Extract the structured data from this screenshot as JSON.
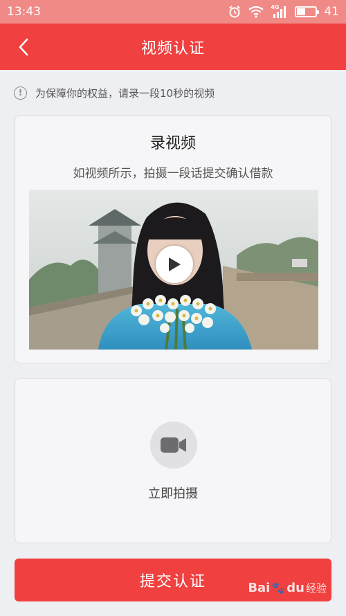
{
  "status_bar": {
    "time": "13:43",
    "network": "4G",
    "battery_level": "41",
    "battery_fraction": 0.41
  },
  "header": {
    "title": "视频认证",
    "back_icon": "chevron-left-icon"
  },
  "notice": {
    "icon": "info-icon",
    "icon_glyph": "!",
    "text": "为保障你的权益，请录一段10秒的视频"
  },
  "video_card": {
    "title": "录视频",
    "subtitle": "如视频所示，拍摄一段话提交确认借款",
    "play_icon": "play-icon"
  },
  "record_card": {
    "camera_icon": "video-camera-icon",
    "label": "立即拍摄"
  },
  "submit": {
    "label": "提交认证"
  },
  "watermark": {
    "brand": "Bai",
    "brand_suffix": "du",
    "product": "经验"
  },
  "colors": {
    "primary": "#f0403f",
    "status_bar": "#f08a86",
    "background": "#eeeff3"
  }
}
